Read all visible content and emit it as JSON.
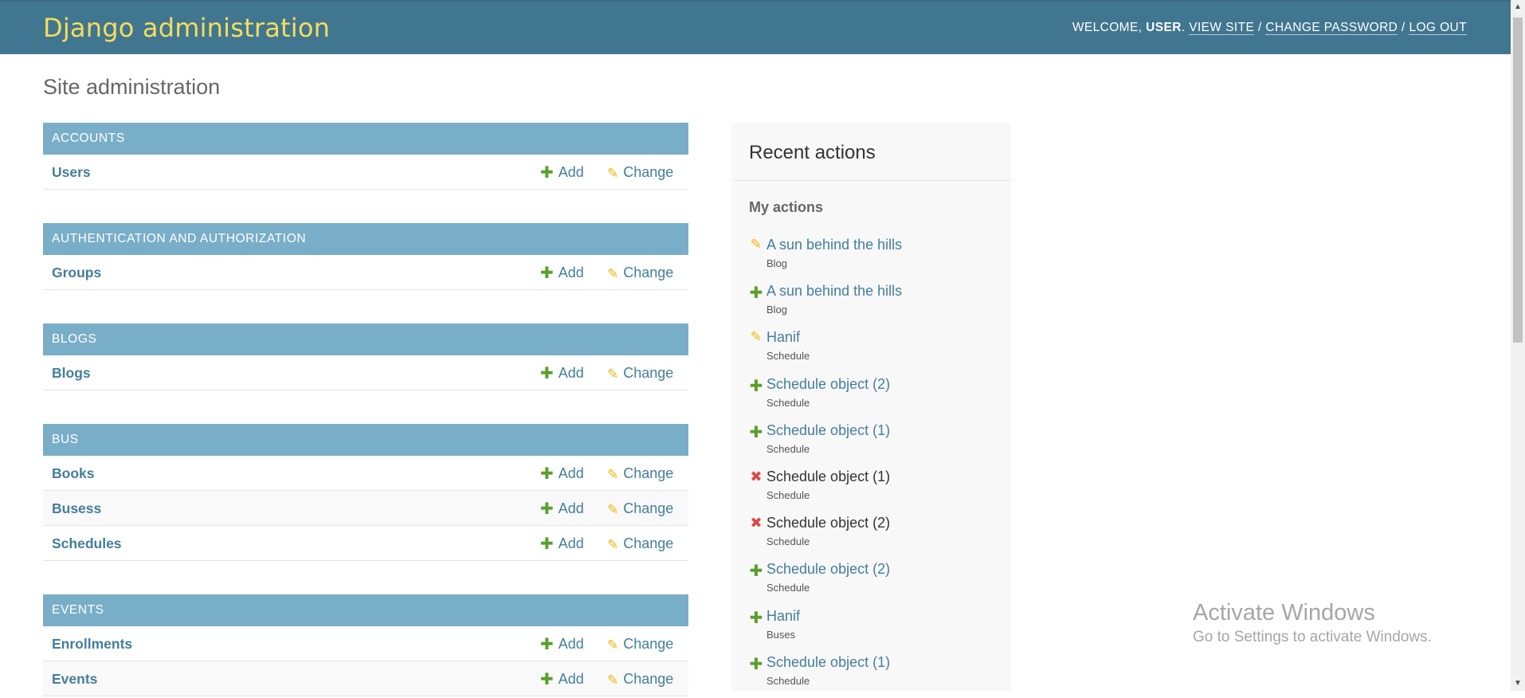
{
  "header": {
    "branding": "Django administration",
    "welcome": "Welcome,",
    "username": "user",
    "view_site": "View site",
    "change_password": "Change password",
    "log_out": "Log out",
    "sep": "/"
  },
  "page_title": "Site administration",
  "link_labels": {
    "add": "Add",
    "change": "Change"
  },
  "apps": [
    {
      "name": "Accounts",
      "models": [
        {
          "name": "Users"
        }
      ]
    },
    {
      "name": "Authentication and Authorization",
      "models": [
        {
          "name": "Groups"
        }
      ]
    },
    {
      "name": "Blogs",
      "models": [
        {
          "name": "Blogs"
        }
      ]
    },
    {
      "name": "Bus",
      "models": [
        {
          "name": "Books"
        },
        {
          "name": "Busess"
        },
        {
          "name": "Schedules"
        }
      ]
    },
    {
      "name": "Events",
      "models": [
        {
          "name": "Enrollments"
        },
        {
          "name": "Events"
        }
      ]
    }
  ],
  "recent_actions": {
    "title": "Recent actions",
    "subtitle": "My actions",
    "items": [
      {
        "action": "change",
        "icon": "pencil-icon",
        "title": "A sun behind the hills",
        "type": "Blog"
      },
      {
        "action": "add",
        "icon": "plus-icon",
        "title": "A sun behind the hills",
        "type": "Blog"
      },
      {
        "action": "change",
        "icon": "pencil-icon",
        "title": "Hanif",
        "type": "Schedule"
      },
      {
        "action": "add",
        "icon": "plus-icon",
        "title": "Schedule object (2)",
        "type": "Schedule"
      },
      {
        "action": "add",
        "icon": "plus-icon",
        "title": "Schedule object (1)",
        "type": "Schedule"
      },
      {
        "action": "delete",
        "icon": "cross-icon",
        "title": "Schedule object (1)",
        "type": "Schedule"
      },
      {
        "action": "delete",
        "icon": "cross-icon",
        "title": "Schedule object (2)",
        "type": "Schedule"
      },
      {
        "action": "add",
        "icon": "plus-icon",
        "title": "Schedule object (2)",
        "type": "Schedule"
      },
      {
        "action": "add",
        "icon": "plus-icon",
        "title": "Hanif",
        "type": "Buses"
      },
      {
        "action": "add",
        "icon": "plus-icon",
        "title": "Schedule object (1)",
        "type": "Schedule"
      }
    ]
  },
  "watermark": {
    "title": "Activate Windows",
    "subtitle": "Go to Settings to activate Windows."
  },
  "colors": {
    "header_bg": "#417690",
    "branding": "#f5dd5d",
    "module_caption_bg": "#79aec8",
    "link": "#447e9b",
    "add_icon": "#5aa02c",
    "change_icon": "#efb80b",
    "delete_icon": "#dd4646"
  }
}
